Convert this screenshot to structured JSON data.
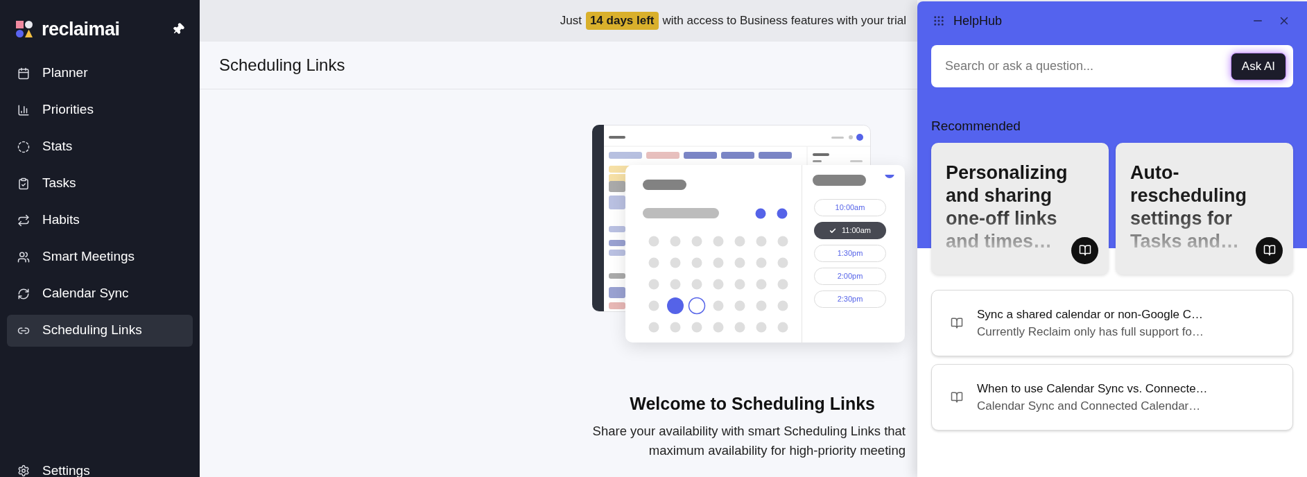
{
  "sidebar": {
    "logo": "reclaimai",
    "items": [
      {
        "label": "Planner",
        "selected": false
      },
      {
        "label": "Priorities",
        "selected": false
      },
      {
        "label": "Stats",
        "selected": false
      },
      {
        "label": "Tasks",
        "selected": false
      },
      {
        "label": "Habits",
        "selected": false
      },
      {
        "label": "Smart Meetings",
        "selected": false
      },
      {
        "label": "Calendar Sync",
        "selected": false
      },
      {
        "label": "Scheduling Links",
        "selected": true
      }
    ],
    "settings": "Settings"
  },
  "banner": {
    "before": "Just",
    "highlight": "14 days left",
    "after": "with access to Business features with your trial"
  },
  "page": {
    "title": "Scheduling Links",
    "illustration": {
      "time_slots": [
        {
          "label": "10:00am",
          "selected": false
        },
        {
          "label": "11:00am",
          "selected": true
        },
        {
          "label": "1:30pm",
          "selected": false
        },
        {
          "label": "2:00pm",
          "selected": false
        },
        {
          "label": "2:30pm",
          "selected": false
        }
      ]
    },
    "welcome_title": "Welcome to Scheduling Links",
    "description_lines": [
      "Share your availability with smart Scheduling Links that",
      "maximum availability for high-priority meeting"
    ]
  },
  "helphub": {
    "title": "HelpHub",
    "search": {
      "placeholder": "Search or ask a question..."
    },
    "ask_button": "Ask AI",
    "section": "Recommended",
    "cards": [
      {
        "title": "Personalizing and sharing one-off links and times…"
      },
      {
        "title": "Auto-rescheduling settings for Tasks and…"
      }
    ],
    "articles": [
      {
        "title": "Sync a shared calendar or non-Google C…",
        "subtitle": "Currently Reclaim only has full support fo…"
      },
      {
        "title": "When to use Calendar Sync vs. Connecte…",
        "subtitle": "Calendar Sync and Connected Calendar…"
      }
    ]
  }
}
